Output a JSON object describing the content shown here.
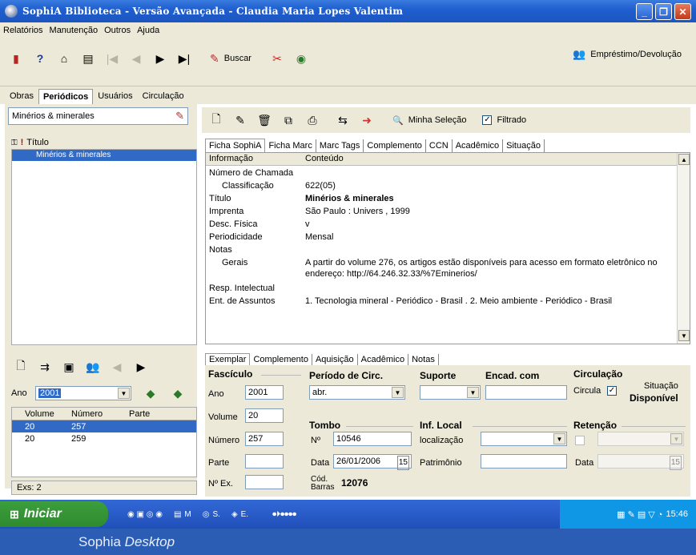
{
  "window": {
    "title": "SophiA Biblioteca - Versão Avançada - Claudia Maria Lopes Valentim"
  },
  "menu": [
    "Relatórios",
    "Manutenção",
    "Outros",
    "Ajuda"
  ],
  "toolbar": {
    "buscar": "Buscar",
    "emprestimo": "Empréstimo/Devolução"
  },
  "main_tabs": [
    "Obras",
    "Periódicos",
    "Usuários",
    "Circulação"
  ],
  "search": {
    "value": "Minérios & minerales"
  },
  "list": {
    "header": "Título",
    "selected": "Minérios & minerales"
  },
  "ano": {
    "label": "Ano",
    "value": "2001"
  },
  "volumes": {
    "headers": [
      "Volume",
      "Número",
      "Parte"
    ],
    "rows": [
      {
        "volume": "20",
        "numero": "257",
        "parte": ""
      },
      {
        "volume": "20",
        "numero": "259",
        "parte": ""
      }
    ]
  },
  "exs": "Exs: 2",
  "right_toolbar": {
    "minha_selecao": "Minha Seleção",
    "filtrado": "Filtrado"
  },
  "detail_tabs": [
    "Ficha SophiA",
    "Ficha Marc",
    "Marc Tags",
    "Complemento",
    "CCN",
    "Acadêmico",
    "Situação"
  ],
  "details": {
    "header": {
      "k": "Informação",
      "v": "Conteúdo"
    },
    "rows": [
      {
        "k": "Número de Chamada",
        "v": ""
      },
      {
        "k": "Classificação",
        "v": "622(05)"
      },
      {
        "k": "Título",
        "v": "Minérios & minerales"
      },
      {
        "k": "Imprenta",
        "v": "São Paulo : Univers , 1999"
      },
      {
        "k": "Desc. Física",
        "v": "v"
      },
      {
        "k": "Periodicidade",
        "v": "Mensal"
      },
      {
        "k": "Notas",
        "v": ""
      },
      {
        "k": "Gerais",
        "v": "A partir do volume 276, os artigos estão disponíveis para acesso em formato eletrônico no endereço: http://64.246.32.33/%7Eminerios/"
      },
      {
        "k": "Resp. Intelectual",
        "v": ""
      },
      {
        "k": "Ent. de Assuntos",
        "v": "1. Tecnologia mineral - Periódico - Brasil . 2. Meio ambiente - Periódico - Brasil"
      }
    ]
  },
  "bottom_tabs": [
    "Exemplar",
    "Complemento",
    "Aquisição",
    "Acadêmico",
    "Notas"
  ],
  "form": {
    "fasciculo": "Fascículo",
    "ano_label": "Ano",
    "ano": "2001",
    "volume_label": "Volume",
    "volume": "20",
    "numero_label": "Número",
    "numero": "257",
    "parte_label": "Parte",
    "nex_label": "Nº Ex.",
    "periodo": "Período de Circ.",
    "periodo_value": "abr.",
    "suporte": "Suporte",
    "encad": "Encad. com",
    "circulacao": "Circulação",
    "circula": "Circula",
    "situacao_label": "Situação",
    "situacao": "Disponível",
    "tombo": "Tombo",
    "n_label": "Nº",
    "tombo_n": "10546",
    "data_label": "Data",
    "tombo_data": "26/01/2006",
    "cod_barras_label": "Cód. Barras",
    "cod_barras": "12076",
    "inf_local": "Inf. Local",
    "localizacao": "localização",
    "patrimonio": "Patrimônio",
    "retencao": "Retenção",
    "ret_data": "Data"
  },
  "taskbar": {
    "start": "Iniciar",
    "tasks": [
      "M",
      "S.",
      "E."
    ],
    "clock": "15:46"
  },
  "caption": {
    "prefix": "Sophia",
    "suffix": "Desktop"
  }
}
